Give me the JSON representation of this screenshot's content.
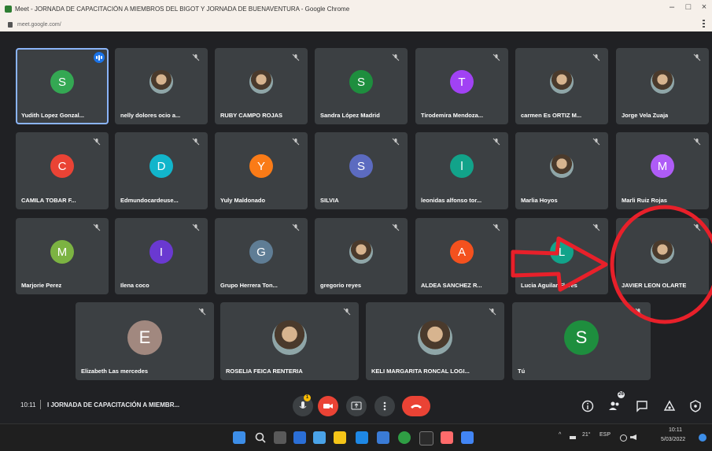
{
  "window": {
    "title": "Meet - JORNADA DE CAPACITACIÓN A MIEMBROS DEL BIGOT Y JORNADA DE BUENAVENTURA - Google Chrome",
    "url": "meet.google.com/",
    "controls": [
      "–",
      "□",
      "×"
    ]
  },
  "participants": [
    {
      "name": "Yudith Lopez Gonzal...",
      "initial": "S",
      "color": "#34a853",
      "speaking": true
    },
    {
      "name": "nelly dolores ocio a...",
      "photo": true
    },
    {
      "name": "RUBY CAMPO ROJAS",
      "photo": true
    },
    {
      "name": "Sandra López Madrid",
      "initial": "S",
      "color": "#1e8e3e"
    },
    {
      "name": "Tirodemira Mendoza...",
      "initial": "T",
      "color": "#a142f4"
    },
    {
      "name": "carmen Es ORTIZ M...",
      "photo": true
    },
    {
      "name": "Jorge Vela Zuaja",
      "photo": true
    },
    {
      "name": "CAMILA TOBAR F...",
      "initial": "C",
      "color": "#ea4335"
    },
    {
      "name": "Edmundocardeuse...",
      "initial": "D",
      "color": "#12b5cb"
    },
    {
      "name": "Yuly Maldonado",
      "initial": "Y",
      "color": "#fa7b17"
    },
    {
      "name": "SILVIA",
      "initial": "S",
      "color": "#5c6bc0"
    },
    {
      "name": "leonidas alfonso tor...",
      "initial": "l",
      "color": "#12a38a"
    },
    {
      "name": "Marlia Hoyos",
      "photo": true
    },
    {
      "name": "Marli Ruiz Rojas",
      "initial": "M",
      "color": "#af5cf7"
    },
    {
      "name": "Marjorie Perez",
      "initial": "M",
      "color": "#7cb342"
    },
    {
      "name": "Ilena coco",
      "initial": "I",
      "color": "#6a39d1"
    },
    {
      "name": "Grupo Herrera Ton...",
      "initial": "G",
      "color": "#5f7d95"
    },
    {
      "name": "gregorio reyes",
      "photo": true
    },
    {
      "name": "ALDEA SANCHEZ R...",
      "initial": "A",
      "color": "#f4511e"
    },
    {
      "name": "Lucia Aguilar Flores",
      "initial": "L",
      "color": "#12a38a"
    },
    {
      "name": "JAVIER LEON OLARTE",
      "photo": true
    },
    {
      "name": "Elizabeth Las mercedes",
      "initial": "E",
      "color": "#a1887f"
    },
    {
      "name": "ROSELIA FEICA RENTERIA",
      "photo": true
    },
    {
      "name": "KELI MARGARITA RONCAL LOGI...",
      "photo": true
    },
    {
      "name": "Tú",
      "initial": "S",
      "color": "#1e8e3e"
    }
  ],
  "bottom_bar": {
    "time": "10:11",
    "separator": "|",
    "meeting_name": "I JORNADA DE CAPACITACIÓN A MIEMBR...",
    "hand_count": "1",
    "participants_count": "26"
  },
  "taskbar": {
    "weather": "21°",
    "lang": "ESP",
    "clock_time": "10:11",
    "clock_date": "5/03/2022"
  },
  "annotation_colors": {
    "arrow": "#e8202a"
  }
}
